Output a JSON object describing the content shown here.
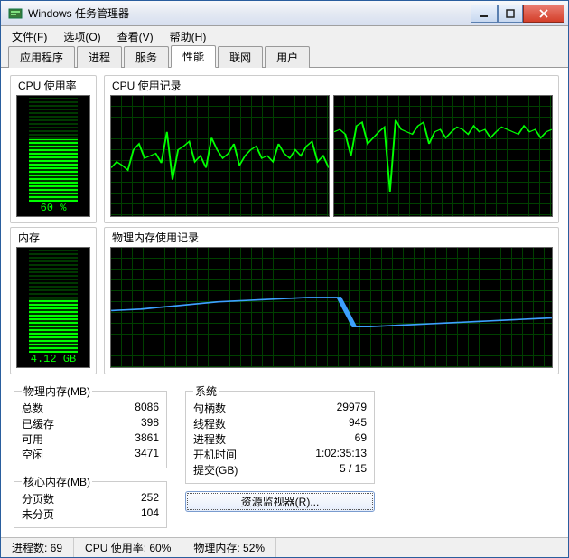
{
  "window": {
    "title": "Windows 任务管理器"
  },
  "menu": {
    "file": "文件(F)",
    "options": "选项(O)",
    "view": "查看(V)",
    "help": "帮助(H)"
  },
  "tabs": {
    "apps": "应用程序",
    "procs": "进程",
    "services": "服务",
    "perf": "性能",
    "net": "联网",
    "users": "用户"
  },
  "labels": {
    "cpu_usage": "CPU 使用率",
    "cpu_history": "CPU 使用记录",
    "mem": "内存",
    "mem_history": "物理内存使用记录",
    "cpu_pct": "60 %",
    "mem_val": "4.12 GB",
    "phys_mem": "物理内存(MB)",
    "total": "总数",
    "cached": "已缓存",
    "avail": "可用",
    "free": "空闲",
    "kernel_mem": "核心内存(MB)",
    "paged": "分页数",
    "nonpaged": "未分页",
    "system": "系统",
    "handles": "句柄数",
    "threads": "线程数",
    "processes": "进程数",
    "uptime": "开机时间",
    "commit": "提交(GB)",
    "resource_btn": "资源监视器(R)..."
  },
  "values": {
    "total": "8086",
    "cached": "398",
    "avail": "3861",
    "free": "3471",
    "paged": "252",
    "nonpaged": "104",
    "handles": "29979",
    "threads": "945",
    "processes": "69",
    "uptime": "1:02:35:13",
    "commit": "5 / 15"
  },
  "status": {
    "procs": "进程数: 69",
    "cpu": "CPU 使用率: 60%",
    "mem": "物理内存: 52%"
  },
  "chart_data": [
    {
      "type": "line",
      "title": "CPU 使用记录 (核心1)",
      "ylim": [
        0,
        100
      ],
      "values": [
        40,
        45,
        42,
        38,
        55,
        60,
        48,
        50,
        52,
        44,
        70,
        30,
        55,
        58,
        62,
        45,
        50,
        40,
        65,
        55,
        48,
        52,
        60,
        42,
        50,
        55,
        58,
        48,
        50,
        45,
        60,
        52,
        48,
        55,
        50,
        58,
        62,
        45,
        50,
        40
      ]
    },
    {
      "type": "line",
      "title": "CPU 使用记录 (核心2)",
      "ylim": [
        0,
        100
      ],
      "values": [
        70,
        72,
        68,
        50,
        75,
        78,
        60,
        65,
        70,
        74,
        20,
        80,
        72,
        70,
        68,
        75,
        78,
        60,
        70,
        72,
        65,
        70,
        74,
        72,
        68,
        75,
        70,
        72,
        65,
        70,
        74,
        72,
        70,
        68,
        75,
        70,
        72,
        65,
        70,
        72
      ]
    },
    {
      "type": "line",
      "title": "物理内存使用记录",
      "ylim": [
        0,
        8192
      ],
      "values": [
        3900,
        3950,
        4000,
        4100,
        4200,
        4300,
        4400,
        4500,
        4550,
        4600,
        4650,
        4700,
        4750,
        4800,
        4800,
        4800,
        2800,
        2800,
        2850,
        2900,
        2950,
        3000,
        3050,
        3100,
        3150,
        3200,
        3250,
        3300,
        3350,
        3400
      ]
    }
  ]
}
